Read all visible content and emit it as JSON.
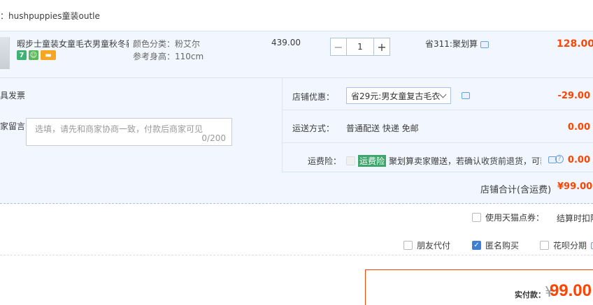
{
  "store": {
    "name": "：hushpuppies童装outle"
  },
  "item": {
    "title": "暇步士童装女童毛衣男童秋冬新...",
    "sku_color": "颜色分类：粉艾尔",
    "sku_height": "参考身高：110cm",
    "unit_price": "439.00",
    "qty_minus": "−",
    "quantity": "1",
    "qty_plus": "+",
    "promo": "省311:聚划算",
    "subtotal": "128.00",
    "badge_1": "7",
    "badge_icons": [
      "seven-day-return-icon",
      "guarantee-icon",
      "card-icon"
    ]
  },
  "invoice": {
    "label": "具发票"
  },
  "message": {
    "label": "家留言：",
    "placeholder": "选填，请先和商家协商一致，付款后商家可见",
    "count": "0/200"
  },
  "store_discount": {
    "label": "店铺优惠：",
    "selected": "省29元:男女童复古毛衣",
    "amount": "-29.00"
  },
  "shipping": {
    "label": "运送方式：",
    "method": "普通配送 快递 免邮",
    "amount": "0.00"
  },
  "freight_insurance": {
    "label": "运费险：",
    "tag": "运费险",
    "text": "聚划算卖家赠送，若确认收货前退货，可获...",
    "amount": "0.00"
  },
  "store_total": {
    "label": "店铺合计(含运费)",
    "amount": "¥99.00"
  },
  "tmall_points": {
    "label": "使用天猫点券：",
    "note": "结算时扣除"
  },
  "options": {
    "friend_pay": "朋友代付",
    "anonymous": "匿名购买",
    "huabei": "花呗分期"
  },
  "payment": {
    "label": "实付款：",
    "currency": "¥",
    "amount": "99.00"
  },
  "colors": {
    "price_red": "#ff4400",
    "panel_bg": "#f2f7ff",
    "checkbox_blue": "#3d7fd4"
  }
}
